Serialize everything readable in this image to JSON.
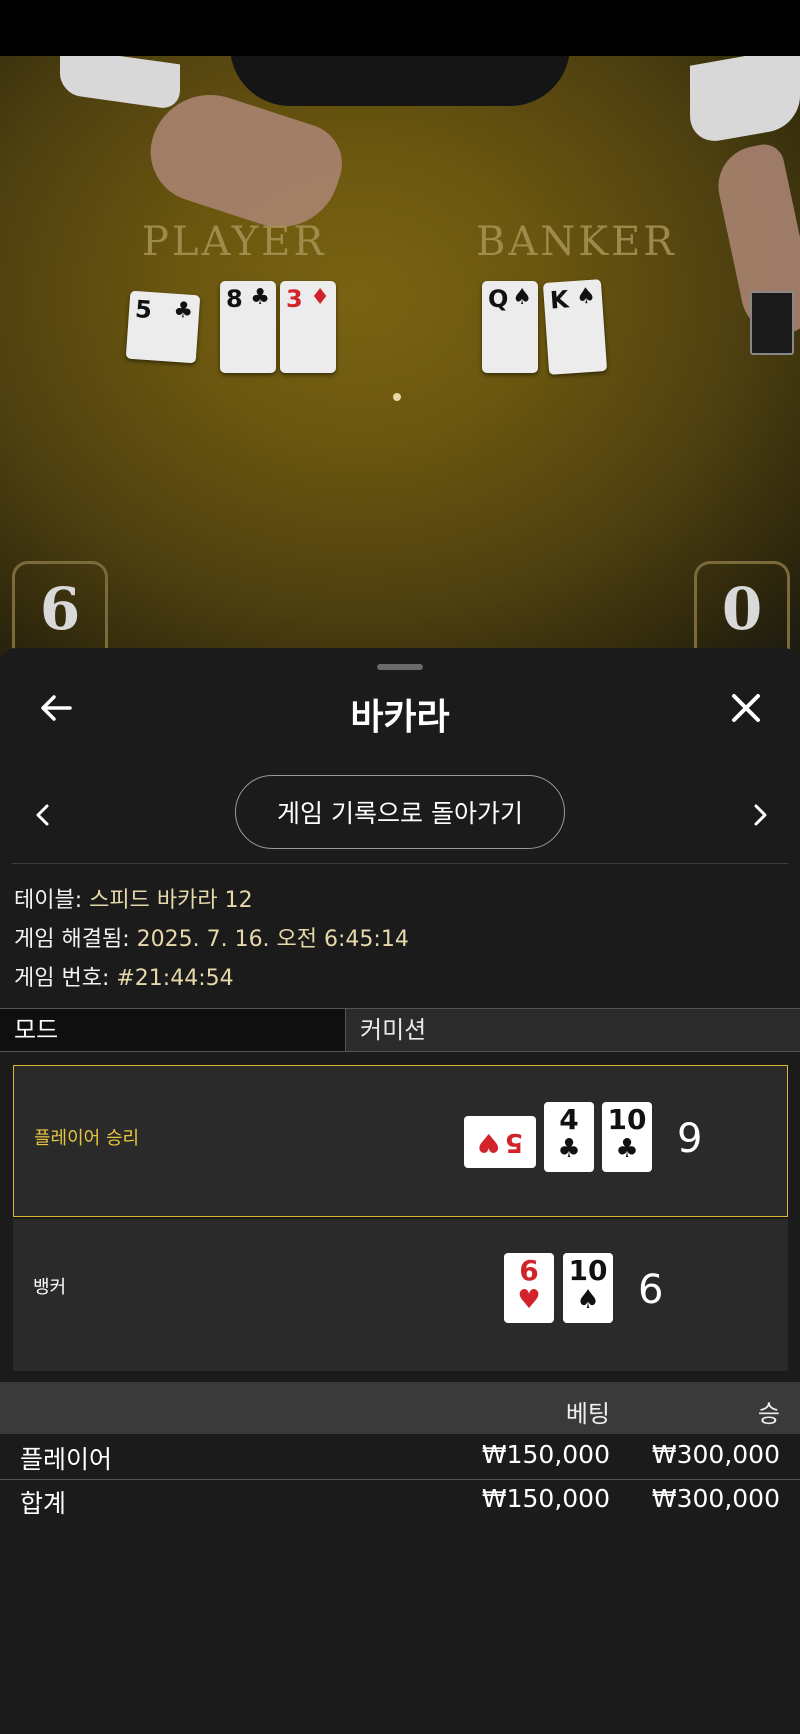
{
  "video": {
    "player_label": "PLAYER",
    "banker_label": "BANKER",
    "player_score": "6",
    "banker_score": "0",
    "player_cards": [
      {
        "rank": "5",
        "suit": "♣",
        "color": "black"
      },
      {
        "rank": "8",
        "suit": "♣",
        "color": "black"
      },
      {
        "rank": "3",
        "suit": "♦",
        "color": "red"
      }
    ],
    "banker_cards": [
      {
        "rank": "Q",
        "suit": "♠",
        "color": "black"
      },
      {
        "rank": "K",
        "suit": "♠",
        "color": "black"
      }
    ]
  },
  "header": {
    "title": "바카라",
    "back_icon": "arrow-left-icon",
    "close_icon": "close-icon"
  },
  "nav": {
    "history_button": "게임 기록으로 돌아가기",
    "prev_icon": "chevron-left-icon",
    "next_icon": "chevron-right-icon"
  },
  "info": {
    "table_label": "테이블:",
    "table_value": "스피드 바카라 12",
    "resolved_label": "게임 해결됨:",
    "resolved_value": "2025. 7. 16. 오전 6:45:14",
    "game_no_label": "게임 번호:",
    "game_no_value": "#21:44:54"
  },
  "mode": {
    "label": "모드",
    "value": "커미션"
  },
  "results": {
    "player": {
      "name": "플레이어 승리",
      "total": "9",
      "cards": [
        {
          "rank": "5",
          "suit": "♥",
          "color": "red",
          "sideways": true
        },
        {
          "rank": "4",
          "suit": "♣",
          "color": "black"
        },
        {
          "rank": "10",
          "suit": "♣",
          "color": "black"
        }
      ]
    },
    "banker": {
      "name": "뱅커",
      "total": "6",
      "cards": [
        {
          "rank": "6",
          "suit": "♥",
          "color": "red"
        },
        {
          "rank": "10",
          "suit": "♠",
          "color": "black"
        }
      ]
    }
  },
  "bets": {
    "headers": {
      "bet": "베팅",
      "win": "승"
    },
    "rows": [
      {
        "name": "플레이어",
        "bet": "₩150,000",
        "win": "₩300,000"
      }
    ],
    "total": {
      "name": "합계",
      "bet": "₩150,000",
      "win": "₩300,000"
    }
  },
  "colors": {
    "accent_gold": "#e8c640",
    "background": "#1b1b1b",
    "card_red": "#d2232a"
  }
}
